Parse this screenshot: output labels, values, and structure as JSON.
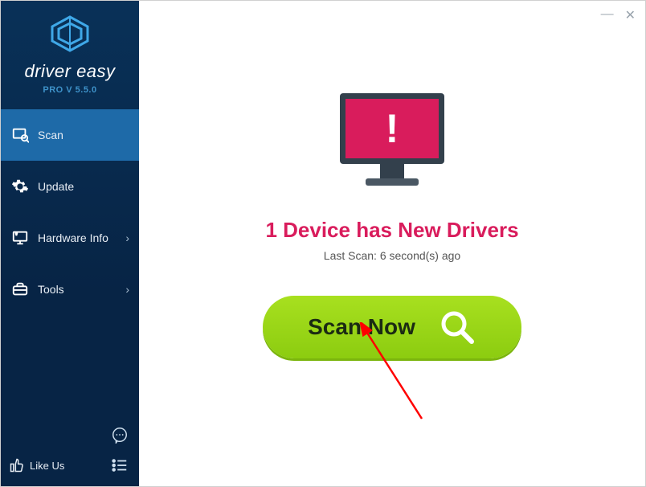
{
  "brand": {
    "name": "driver easy",
    "sub": "PRO V 5.5.0"
  },
  "sidebar": {
    "items": [
      {
        "label": "Scan"
      },
      {
        "label": "Update"
      },
      {
        "label": "Hardware Info"
      },
      {
        "label": "Tools"
      }
    ],
    "like_us": "Like Us"
  },
  "main": {
    "headline": "1 Device has New Drivers",
    "subline": "Last Scan: 6 second(s) ago",
    "scan_button": "Scan Now"
  },
  "colors": {
    "accent_pink": "#d91c5c",
    "sidebar_bg": "#0a2a47",
    "sidebar_active": "#1e6aa8",
    "button_green": "#9ad61a"
  }
}
